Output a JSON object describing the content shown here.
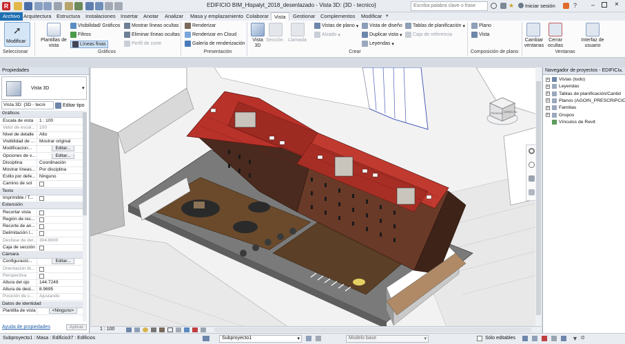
{
  "window": {
    "title": "EDIFICIO BIM_Hispalyt_2018_desenlazado - Vista 3D: {3D - tecnico}",
    "search_placeholder": "Escriba palabra clave o frase",
    "signin": "Iniciar sesión"
  },
  "tabs": [
    "Archivo",
    "Arquitectura",
    "Estructura",
    "Instalaciones",
    "Insertar",
    "Anotar",
    "Analizar",
    "Masa y emplazamiento",
    "Colaborar",
    "Vista",
    "Gestionar",
    "Complementos",
    "Modificar"
  ],
  "active_tab": "Vista",
  "ribbon": {
    "modify": "Modificar",
    "select_group": "Seleccionar",
    "view_templates": "Plantillas de vista",
    "visibility": "Visibilidad/ Gráficos",
    "filters": "Filtros",
    "thin_lines": "Líneas finas",
    "show_hidden": "Mostrar líneas ocultas",
    "remove_hidden": "Eliminar líneas ocultas",
    "cut_profile": "Perfil de corte",
    "graphics_group": "Gráficos",
    "render": "Renderizar",
    "render_cloud": "Renderizar  en Cloud",
    "render_gallery": "Galería de  renderización",
    "presentation_group": "Presentación",
    "view3d": "Vista 3D",
    "section": "Sección",
    "callout": "Llamada",
    "plan_views": "Vistas de plano",
    "elevation": "Alzado",
    "drafting_view": "Vista de diseño",
    "duplicate_view": "Duplicar vista",
    "legends": "Leyendas",
    "schedules": "Tablas de planificación",
    "ref_box": "Caja de referencia",
    "create_group": "Crear",
    "sheet": "Plano",
    "view": "Vista",
    "sheet_group": "Composición de plano",
    "switch_windows": "Cambiar ventanas",
    "close_hidden": "Cerrar ocultas",
    "ui": "Interfaz de usuario",
    "windows_group": "Ventanas"
  },
  "properties": {
    "title": "Propiedades",
    "type": "Vista 3D",
    "instance_selector": "Vista 3D: {3D - tecni",
    "edit_type": "Editar tipo",
    "help_link": "Ayuda de propiedades",
    "apply": "Aplicar",
    "sections": [
      {
        "name": "Gráficos",
        "rows": [
          {
            "k": "Escala de vista",
            "v": "1 : 100"
          },
          {
            "k": "Valor de escal...",
            "v": "100",
            "dim": true
          },
          {
            "k": "Nivel de detalle",
            "v": "Alto"
          },
          {
            "k": "Visibilidad de ...",
            "v": "Mostrar original"
          },
          {
            "k": "Modificacion...",
            "v": "Editar...",
            "button": true
          },
          {
            "k": "Opciones de v...",
            "v": "Editar...",
            "button": true
          },
          {
            "k": "Disciplina",
            "v": "Coordinación"
          },
          {
            "k": "Mostrar líneas...",
            "v": "Por disciplina"
          },
          {
            "k": "Estilo por defe...",
            "v": "Ninguno"
          },
          {
            "k": "Camino de sol",
            "v": "",
            "check": true
          }
        ]
      },
      {
        "name": "Texto",
        "rows": [
          {
            "k": "Imprimible / T...",
            "v": "",
            "check": true
          }
        ]
      },
      {
        "name": "Extensión",
        "rows": [
          {
            "k": "Recortar vista",
            "v": "",
            "check": true
          },
          {
            "k": "Región de rec...",
            "v": "",
            "check": true
          },
          {
            "k": "Recorte de an...",
            "v": "",
            "check": true
          },
          {
            "k": "Delimitación l...",
            "v": "",
            "check": true
          },
          {
            "k": "Desfase de del...",
            "v": "304.8000",
            "dim": true
          },
          {
            "k": "Caja de sección",
            "v": "",
            "check": true
          }
        ]
      },
      {
        "name": "Cámara",
        "rows": [
          {
            "k": "Configuració...",
            "v": "Editar...",
            "button": true
          },
          {
            "k": "Orientación bl...",
            "v": "",
            "check": true,
            "dim": true
          },
          {
            "k": "Perspectiva",
            "v": "",
            "check": true,
            "dim": true
          },
          {
            "k": "Altura del ojo",
            "v": "144.7249"
          },
          {
            "k": "Altura de dest...",
            "v": "8.9695"
          },
          {
            "k": "Posición de c...",
            "v": "Ajustando",
            "dim": true
          }
        ]
      },
      {
        "name": "Datos de identidad",
        "rows": [
          {
            "k": "Plantilla de vista",
            "v": "<Ninguno>",
            "button": true
          }
        ]
      }
    ]
  },
  "navigator": {
    "title": "Navegador de proyectos - EDIFICI...",
    "items": [
      "Vistas (todo)",
      "Leyendas",
      "Tablas de planificación/Cantid",
      "Planos (AGOIN_PRESCRIPCION",
      "Familias",
      "Grupos",
      "Vínculos de Revit"
    ]
  },
  "viewcube": {
    "front": "FRONTAL",
    "right": "DERECHA"
  },
  "view_controls": {
    "scale": "1 : 100"
  },
  "statusbar": {
    "left": "Subproyecto1 : Masa : Edificio37 : Edificios",
    "workset": "Subproyecto1",
    "design_option": "Modelo base",
    "editable_only": "Sólo editables",
    "selection_count": ":0"
  }
}
